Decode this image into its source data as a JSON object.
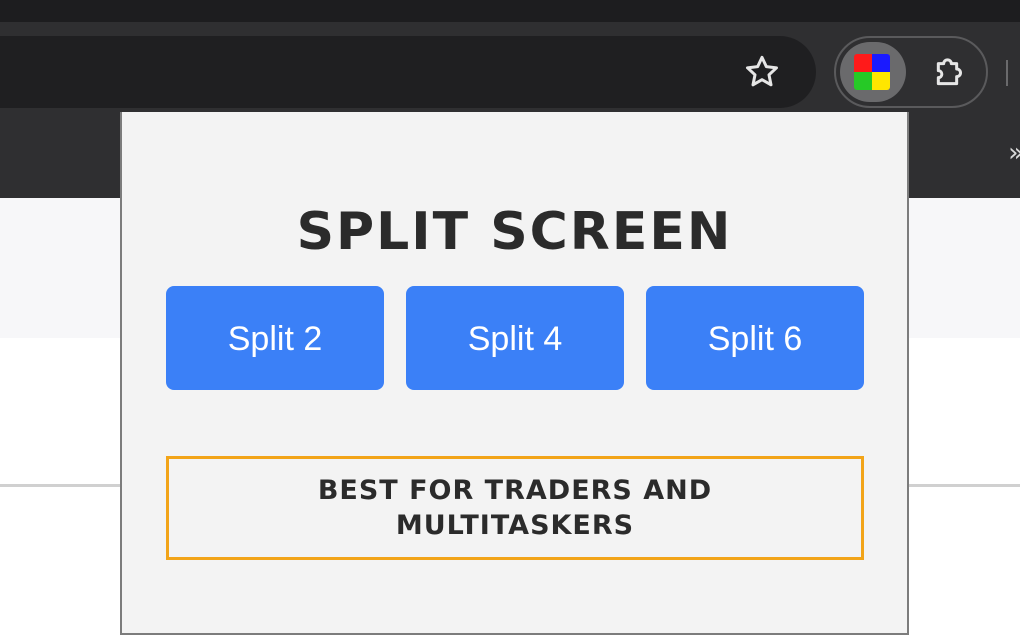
{
  "browser": {
    "icons": {
      "bookmark": "star-icon",
      "extension": "split-screen-tiles-icon",
      "extensions_menu": "puzzle-icon",
      "overflow": "chevrons-icon"
    },
    "overflow_chevrons": "»",
    "tile_colors": [
      "#ff1a1a",
      "#1a1aff",
      "#26c926",
      "#ffe600"
    ]
  },
  "popup": {
    "title": "SPLIT SCREEN",
    "buttons": [
      {
        "label": "Split 2"
      },
      {
        "label": "Split 4"
      },
      {
        "label": "Split 6"
      }
    ],
    "tagline": "BEST FOR TRADERS AND MULTITASKERS",
    "colors": {
      "button": "#3b80f7",
      "tagline_border": "#f2a418",
      "background": "#f3f3f3"
    }
  }
}
